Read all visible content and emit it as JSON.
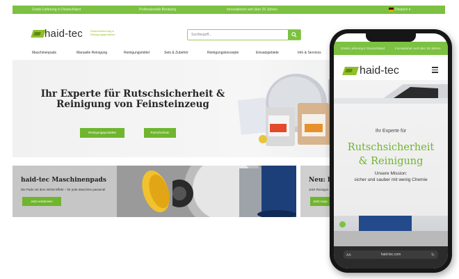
{
  "desktop": {
    "topbar": {
      "items": [
        "Gratis Lieferung in Deutschland",
        "Professionelle Beratung",
        "Innovationen seit über 25 Jahren"
      ],
      "language": "Deutsch"
    },
    "logo": {
      "text": "haid-tec",
      "tagline": "Rutschhemmung & Reinigungsprodukte"
    },
    "search": {
      "placeholder": "Suchbegriff..."
    },
    "nav": [
      "Maschinenpads",
      "Manuelle Reinigung",
      "Reinigungsmittel",
      "Sets & Zubehör",
      "Reinigungskonzepte",
      "Einsatzgebiete",
      "Info & Services"
    ],
    "hero": {
      "title_line1": "Ihr Experte für Rutschsicherheit &",
      "title_line2": "Reinigung von Feinsteinzeug",
      "button1": "Reinigungsprodukte",
      "button2": "Rutschschutz"
    },
    "card1": {
      "title": "haid-tec Maschinenpads",
      "text": "Die Pads mit dem WOW Effekt – für jede Maschine passend!",
      "button": "Jetzt entdecken"
    },
    "card2": {
      "title": "Neu: ha",
      "text": "Jetzt Reinigun",
      "button": "Jetzt Ausp"
    }
  },
  "phone": {
    "topbar": {
      "left": "Gratis Lieferung in Deutschland",
      "right": "Innovationen seit über 25 Jahren"
    },
    "logo": {
      "text": "haid-tec"
    },
    "hero": {
      "intro": "Ihr Experte für",
      "title_line1": "Rutschsicherheit",
      "title_line2": "& Reinigung",
      "mission_line1": "Unsere Mission:",
      "mission_line2": "sicher und sauber mit wenig Chemie"
    },
    "browser": {
      "aa": "AA",
      "url": "haid-tec.com"
    }
  },
  "colors": {
    "brand_green": "#7cc142",
    "button_green": "#6fb52e",
    "logo_green": "#8fbf2a"
  }
}
